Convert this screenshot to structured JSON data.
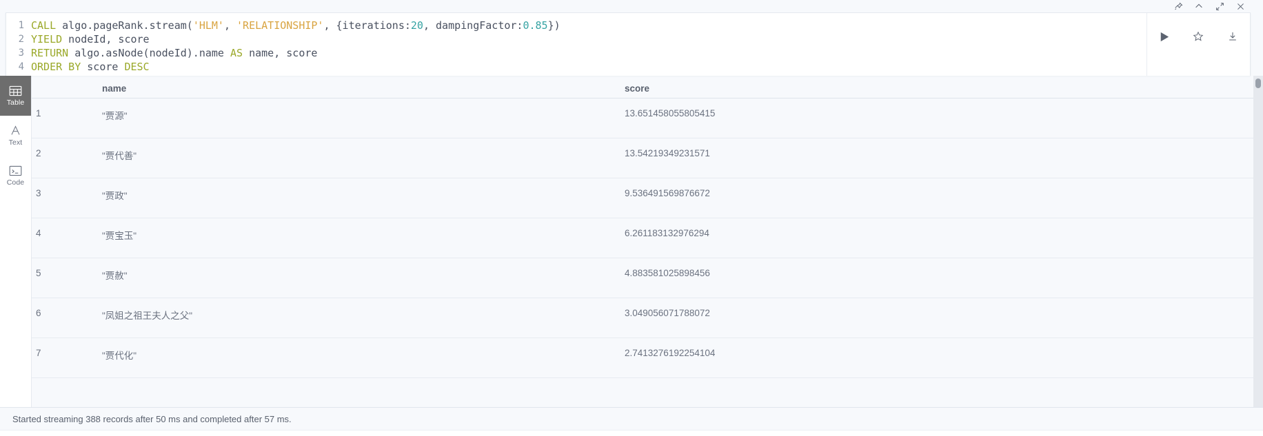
{
  "window": {
    "controls": [
      {
        "name": "pin-icon",
        "label": "Pin"
      },
      {
        "name": "chevron-up-icon",
        "label": "Collapse"
      },
      {
        "name": "expand-icon",
        "label": "Expand"
      },
      {
        "name": "close-icon",
        "label": "Close"
      }
    ]
  },
  "editor": {
    "lines": [
      {
        "number": "1",
        "tokens": [
          {
            "t": "kw",
            "v": "CALL"
          },
          {
            "t": "pl",
            "v": " algo.pageRank.stream("
          },
          {
            "t": "str",
            "v": "'HLM'"
          },
          {
            "t": "pl",
            "v": ", "
          },
          {
            "t": "str",
            "v": "'RELATIONSHIP'"
          },
          {
            "t": "pl",
            "v": ", {iterations:"
          },
          {
            "t": "num",
            "v": "20"
          },
          {
            "t": "pl",
            "v": ", dampingFactor:"
          },
          {
            "t": "num",
            "v": "0.85"
          },
          {
            "t": "pl",
            "v": "})"
          }
        ]
      },
      {
        "number": "2",
        "tokens": [
          {
            "t": "kw",
            "v": "YIELD"
          },
          {
            "t": "pl",
            "v": " nodeId, score"
          }
        ]
      },
      {
        "number": "3",
        "tokens": [
          {
            "t": "kw",
            "v": "RETURN"
          },
          {
            "t": "pl",
            "v": " algo.asNode(nodeId).name "
          },
          {
            "t": "kw",
            "v": "AS"
          },
          {
            "t": "pl",
            "v": " name, score"
          }
        ]
      },
      {
        "number": "4",
        "tokens": [
          {
            "t": "kw",
            "v": "ORDER BY"
          },
          {
            "t": "pl",
            "v": " score "
          },
          {
            "t": "kw",
            "v": "DESC"
          }
        ]
      }
    ],
    "actions": [
      {
        "name": "run-query-button",
        "label": "Run"
      },
      {
        "name": "favorite-button",
        "label": "Save as favorite"
      },
      {
        "name": "download-button",
        "label": "Download"
      }
    ]
  },
  "view_switcher": {
    "items": [
      {
        "label": "Table",
        "icon": "table-icon",
        "active": true
      },
      {
        "label": "Text",
        "icon": "text-icon",
        "active": false
      },
      {
        "label": "Code",
        "icon": "code-icon",
        "active": false
      }
    ]
  },
  "results": {
    "columns": [
      "name",
      "score"
    ],
    "rows": [
      {
        "idx": "1",
        "name": "\"贾源\"",
        "score": "13.651458055805415"
      },
      {
        "idx": "2",
        "name": "\"贾代善\"",
        "score": "13.54219349231571"
      },
      {
        "idx": "3",
        "name": "\"贾政\"",
        "score": "9.536491569876672"
      },
      {
        "idx": "4",
        "name": "\"贾宝玉\"",
        "score": "6.261183132976294"
      },
      {
        "idx": "5",
        "name": "\"贾赦\"",
        "score": "4.883581025898456"
      },
      {
        "idx": "6",
        "name": "\"凤姐之祖王夫人之父\"",
        "score": "3.049056071788072"
      },
      {
        "idx": "7",
        "name": "\"贾代化\"",
        "score": "2.7413276192254104"
      }
    ]
  },
  "status": {
    "message": "Started streaming 388 records after 50 ms and completed after 57 ms."
  },
  "colors": {
    "accent": "#1a8cf0",
    "keyword": "#9aa828",
    "string": "#d9a441",
    "number": "#36a3a3",
    "active_tab_bg": "#6d6d6d",
    "pane_bg": "#f7f9fc"
  }
}
